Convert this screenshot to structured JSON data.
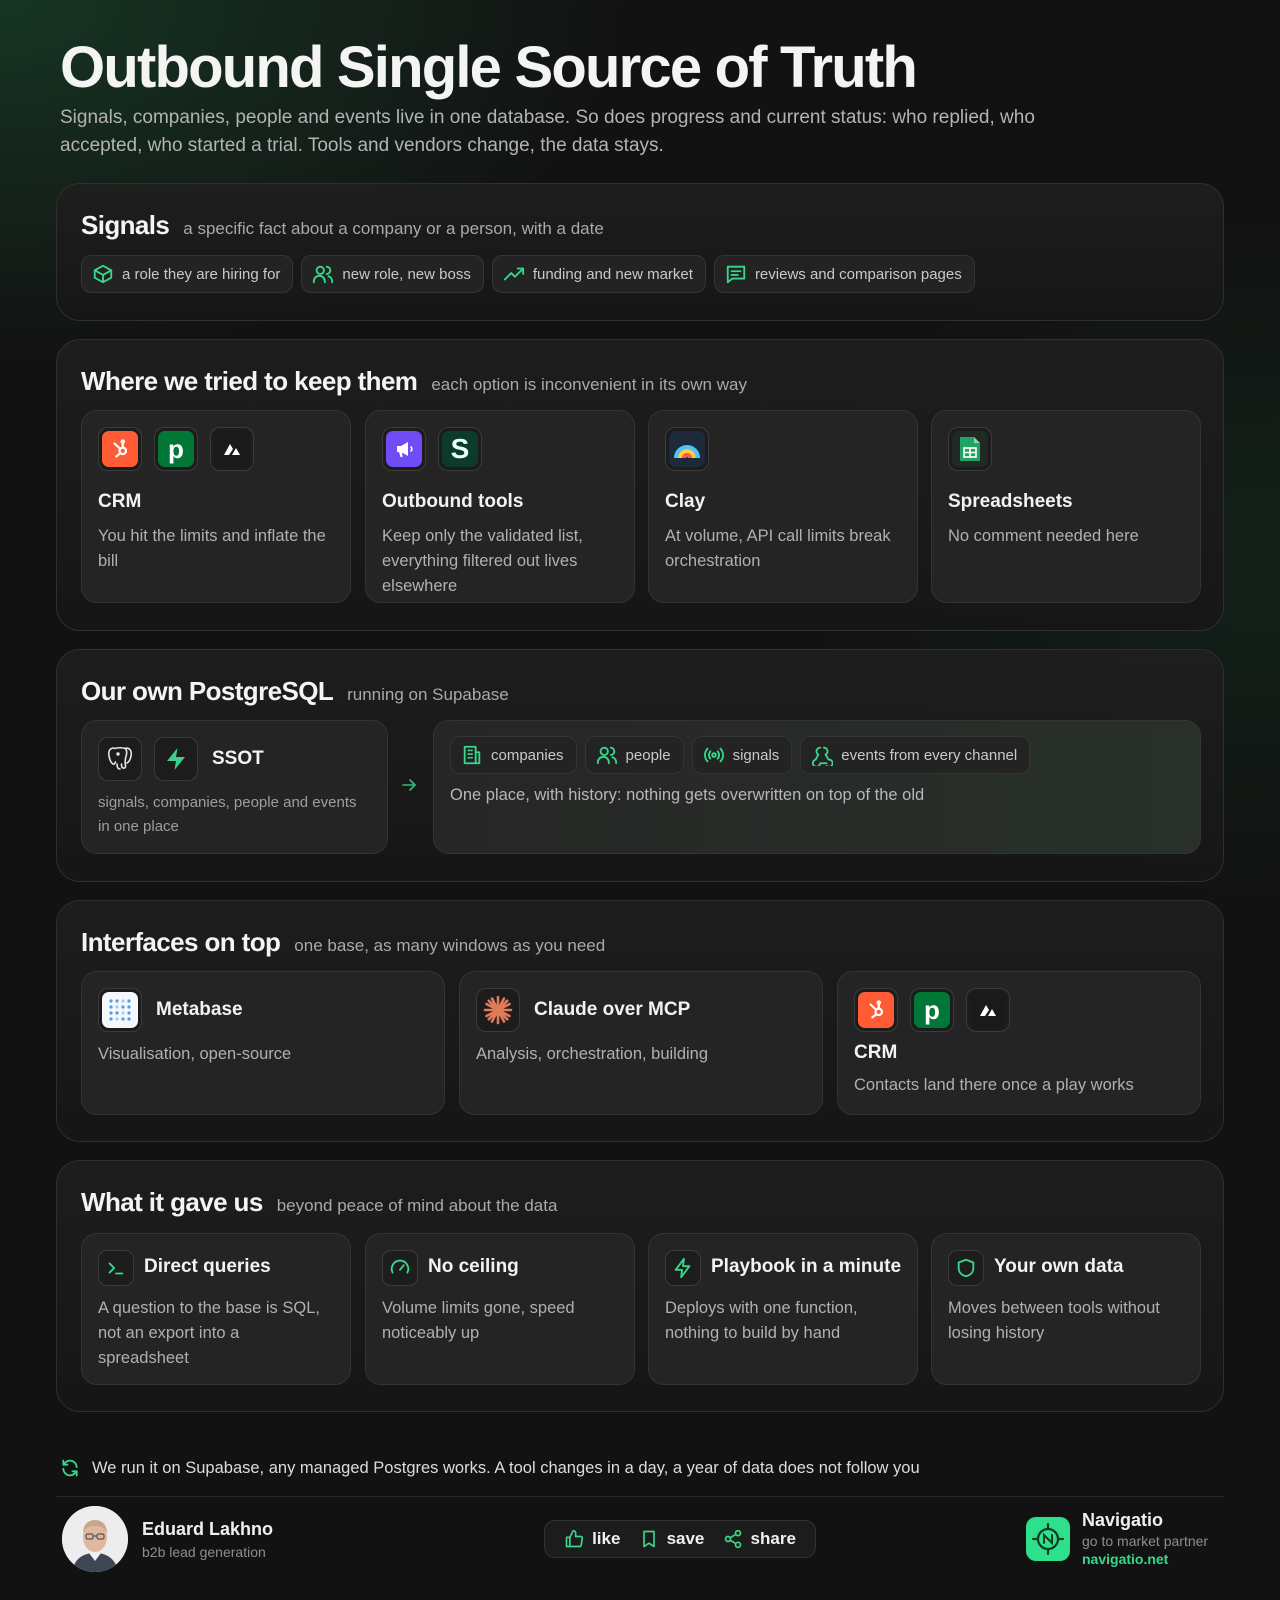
{
  "header": {
    "title": "Outbound Single Source of Truth",
    "subtitle": "Signals, companies, people and events live in one database. So does progress and current status: who replied, who accepted, who started a trial. Tools and vendors change, the data stays."
  },
  "signals": {
    "title": "Signals",
    "subtitle": "a specific fact about a company or a person, with a date",
    "chips": [
      {
        "label": "a role they are hiring for",
        "icon": "cube-icon"
      },
      {
        "label": "new role, new boss",
        "icon": "users-icon"
      },
      {
        "label": "funding and new market",
        "icon": "trending-up-icon"
      },
      {
        "label": "reviews and comparison pages",
        "icon": "message-square-icon"
      }
    ]
  },
  "storage": {
    "title": "Where we tried to keep them",
    "subtitle": "each option is inconvenient in its own way",
    "cards": [
      {
        "title": "CRM",
        "text": "You hit the limits and inflate the bill",
        "logos": [
          "hubspot-logo",
          "pipedrive-logo",
          "attio-logo"
        ]
      },
      {
        "title": "Outbound tools",
        "text": "Keep only the validated list, everything filtered out lives elsewhere",
        "logos": [
          "lemlist-logo",
          "smartlead-logo"
        ]
      },
      {
        "title": "Clay",
        "text": "At volume, API call limits break orchestration",
        "logos": [
          "clay-logo"
        ]
      },
      {
        "title": "Spreadsheets",
        "text": "No comment needed here",
        "logos": [
          "google-sheets-logo"
        ]
      }
    ],
    "pipedrive_letter": "p",
    "smartlead_letter": "S"
  },
  "postgres": {
    "title": "Our own PostgreSQL",
    "subtitle": "running on Supabase",
    "ssot_title": "SSOT",
    "ssot_text": "signals, companies, people and events in one place",
    "chips": [
      {
        "label": "companies",
        "icon": "building-icon"
      },
      {
        "label": "people",
        "icon": "users-icon"
      },
      {
        "label": "signals",
        "icon": "radio-icon"
      },
      {
        "label": "events from every channel",
        "icon": "webhook-icon"
      }
    ],
    "note": "One place, with history: nothing gets overwritten on top of the old"
  },
  "interfaces": {
    "title": "Interfaces on top",
    "subtitle": "one base, as many windows as you need",
    "cards": [
      {
        "title": "Metabase",
        "text": "Visualisation, open-source",
        "logo": "metabase-logo"
      },
      {
        "title": "Claude over MCP",
        "text": "Analysis, orchestration, building",
        "logo": "claude-logo"
      },
      {
        "title": "CRM",
        "text": "Contacts land there once a play works",
        "logos": [
          "hubspot-logo",
          "pipedrive-logo",
          "attio-logo"
        ]
      }
    ]
  },
  "benefits": {
    "title": "What it gave us",
    "subtitle": "beyond peace of mind about the data",
    "cards": [
      {
        "title": "Direct queries",
        "text": "A question to the base is SQL, not an export into a spreadsheet",
        "icon": "terminal-icon"
      },
      {
        "title": "No ceiling",
        "text": "Volume limits gone, speed noticeably up",
        "icon": "gauge-icon"
      },
      {
        "title": "Playbook in a minute",
        "text": "Deploys with one function, nothing to build by hand",
        "icon": "zap-icon"
      },
      {
        "title": "Your own data",
        "text": "Moves between tools without losing history",
        "icon": "shield-icon"
      }
    ]
  },
  "footer": {
    "note": "We run it on Supabase, any managed Postgres works. A tool changes in a day, a year of data does not follow you",
    "author_name": "Eduard Lakhno",
    "author_role": "b2b lead generation",
    "actions": [
      "like",
      "save",
      "share"
    ],
    "brand_name": "Navigatio",
    "brand_role": "go to market partner",
    "brand_url": "navigatio.net"
  },
  "colors": {
    "accent": "#36d98a",
    "hubspot": "#ff5c35",
    "pipedrive": "#017737",
    "background": "#121212"
  }
}
